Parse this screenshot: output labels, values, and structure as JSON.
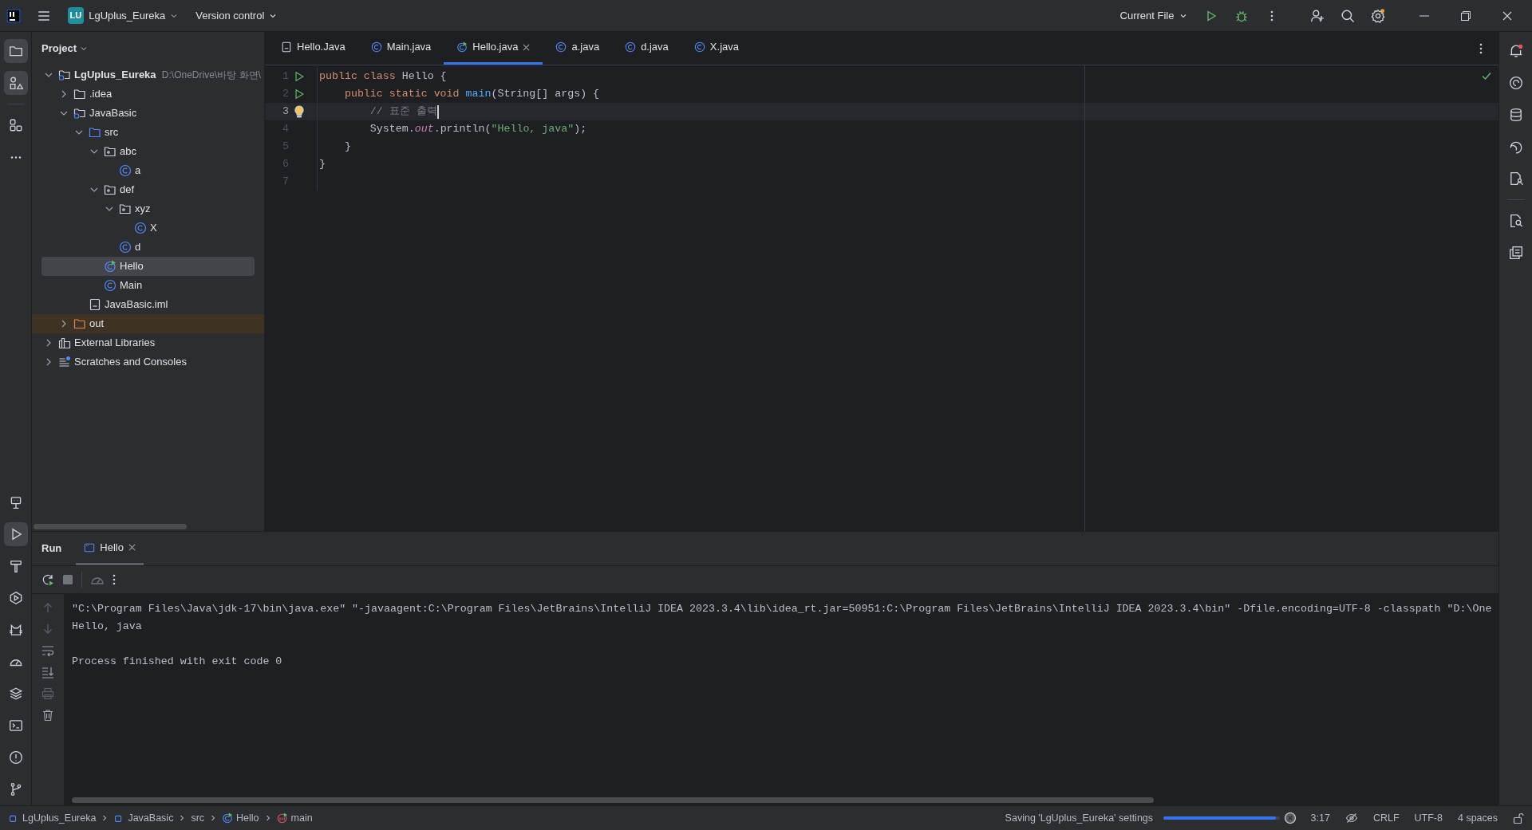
{
  "title_bar": {
    "project_badge": "LU",
    "project": "LgUplus_Eureka",
    "vcs": "Version control",
    "run_config": "Current File"
  },
  "left_toolbar": {
    "top": [
      {
        "kind": "project",
        "selected": true
      },
      {
        "kind": "structure",
        "selected": true
      },
      {
        "kind": "plugins",
        "selected": false
      },
      {
        "kind": "more",
        "selected": false
      }
    ],
    "bottom": [
      {
        "kind": "services",
        "selected": false
      },
      {
        "kind": "run",
        "selected": true
      },
      {
        "kind": "build",
        "selected": false
      },
      {
        "kind": "services-run",
        "selected": false
      },
      {
        "kind": "cat",
        "selected": false
      },
      {
        "kind": "profiler",
        "selected": false
      },
      {
        "kind": "layers",
        "selected": false
      },
      {
        "kind": "terminal",
        "selected": false
      },
      {
        "kind": "problems",
        "selected": false
      },
      {
        "kind": "git",
        "selected": false
      }
    ]
  },
  "project_panel": {
    "title": "Project",
    "tree": [
      {
        "label": "LgUplus_Eureka",
        "path": "D:\\OneDrive\\바탕 화면\\",
        "kind": "module",
        "expanded": true,
        "selected": false,
        "children": [
          {
            "label": ".idea",
            "kind": "folder",
            "expanded": false,
            "selected": false
          },
          {
            "label": "JavaBasic",
            "kind": "module",
            "expanded": true,
            "selected": false,
            "children": [
              {
                "label": "src",
                "kind": "source-folder",
                "expanded": true,
                "selected": false,
                "children": [
                  {
                    "label": "abc",
                    "kind": "package",
                    "expanded": true,
                    "selected": false,
                    "children": [
                      {
                        "label": "a",
                        "kind": "class",
                        "selected": false
                      }
                    ]
                  },
                  {
                    "label": "def",
                    "kind": "package",
                    "expanded": true,
                    "selected": false,
                    "children": [
                      {
                        "label": "xyz",
                        "kind": "package",
                        "expanded": true,
                        "selected": false,
                        "children": [
                          {
                            "label": "X",
                            "kind": "class",
                            "selected": false
                          }
                        ]
                      },
                      {
                        "label": "d",
                        "kind": "class",
                        "selected": false
                      }
                    ]
                  },
                  {
                    "label": "Hello",
                    "kind": "runnable-class",
                    "selected": true
                  },
                  {
                    "label": "Main",
                    "kind": "class",
                    "selected": false
                  }
                ]
              },
              {
                "label": "JavaBasic.iml",
                "kind": "file",
                "selected": false
              }
            ]
          },
          {
            "label": "out",
            "kind": "excluded-folder",
            "expanded": false,
            "selected": false
          }
        ]
      },
      {
        "label": "External Libraries",
        "kind": "libraries",
        "expanded": false,
        "selected": false
      },
      {
        "label": "Scratches and Consoles",
        "kind": "scratches",
        "expanded": false,
        "selected": false
      }
    ]
  },
  "editor": {
    "tabs": [
      {
        "label": "Hello.Java",
        "kind": "file",
        "selected": false
      },
      {
        "label": "Main.java",
        "kind": "class",
        "selected": false
      },
      {
        "label": "Hello.java",
        "kind": "runnable-class",
        "selected": true
      },
      {
        "label": "a.java",
        "kind": "class",
        "selected": false
      },
      {
        "label": "d.java",
        "kind": "class",
        "selected": false
      },
      {
        "label": "X.java",
        "kind": "class",
        "selected": false
      }
    ],
    "lines": [
      {
        "number": "1",
        "run_marker": true,
        "bulb": false,
        "current": false,
        "tokens": [
          {
            "text": "public class ",
            "kind": "keyword"
          },
          {
            "text": "Hello {",
            "kind": "plain"
          }
        ]
      },
      {
        "number": "2",
        "run_marker": true,
        "bulb": false,
        "current": false,
        "tokens": [
          {
            "text": "    public static void ",
            "kind": "keyword"
          },
          {
            "text": "main",
            "kind": "function"
          },
          {
            "text": "(String[] args) {",
            "kind": "plain"
          }
        ]
      },
      {
        "number": "3",
        "run_marker": false,
        "bulb": true,
        "current": true,
        "tokens": [
          {
            "text": "        // 표준 출력",
            "kind": "comment"
          }
        ]
      },
      {
        "number": "4",
        "current": false,
        "tokens": [
          {
            "text": "        System.",
            "kind": "plain"
          },
          {
            "text": "out",
            "kind": "field"
          },
          {
            "text": ".println(",
            "kind": "plain"
          },
          {
            "text": "\"Hello, java\"",
            "kind": "string"
          },
          {
            "text": ");",
            "kind": "plain"
          }
        ]
      },
      {
        "number": "5",
        "current": false,
        "tokens": [
          {
            "text": "    }",
            "kind": "plain"
          }
        ]
      },
      {
        "number": "6",
        "current": false,
        "tokens": [
          {
            "text": "}",
            "kind": "plain"
          }
        ]
      },
      {
        "number": "7",
        "current": false
      }
    ]
  },
  "run_panel": {
    "title": "Run",
    "tabs": [
      {
        "label": "Hello",
        "selected": true
      }
    ],
    "console": [
      {
        "text": "\"C:\\Program Files\\Java\\jdk-17\\bin\\java.exe\" \"-javaagent:C:\\Program Files\\JetBrains\\IntelliJ IDEA 2023.3.4\\lib\\idea_rt.jar=50951:C:\\Program Files\\JetBrains\\IntelliJ IDEA 2023.3.4\\bin\" -Dfile.encoding=UTF-8 -classpath \"D:\\One",
        "kind": "command"
      },
      {
        "text": "Hello, java",
        "kind": "output"
      },
      {
        "text": "Process finished with exit code 0",
        "kind": "exit"
      }
    ]
  },
  "status_bar": {
    "breadcrumbs": [
      {
        "label": "LgUplus_Eureka",
        "kind": "module"
      },
      {
        "label": "JavaBasic",
        "kind": "module"
      },
      {
        "label": "src",
        "kind": "plain"
      },
      {
        "label": "Hello",
        "kind": "class"
      },
      {
        "label": "main",
        "kind": "method"
      }
    ],
    "progress": {
      "label": "Saving 'LgUplus_Eureka' settings",
      "level": 0.97
    },
    "items": [
      "3:17",
      "CRLF",
      "UTF-8",
      "4 spaces"
    ]
  }
}
